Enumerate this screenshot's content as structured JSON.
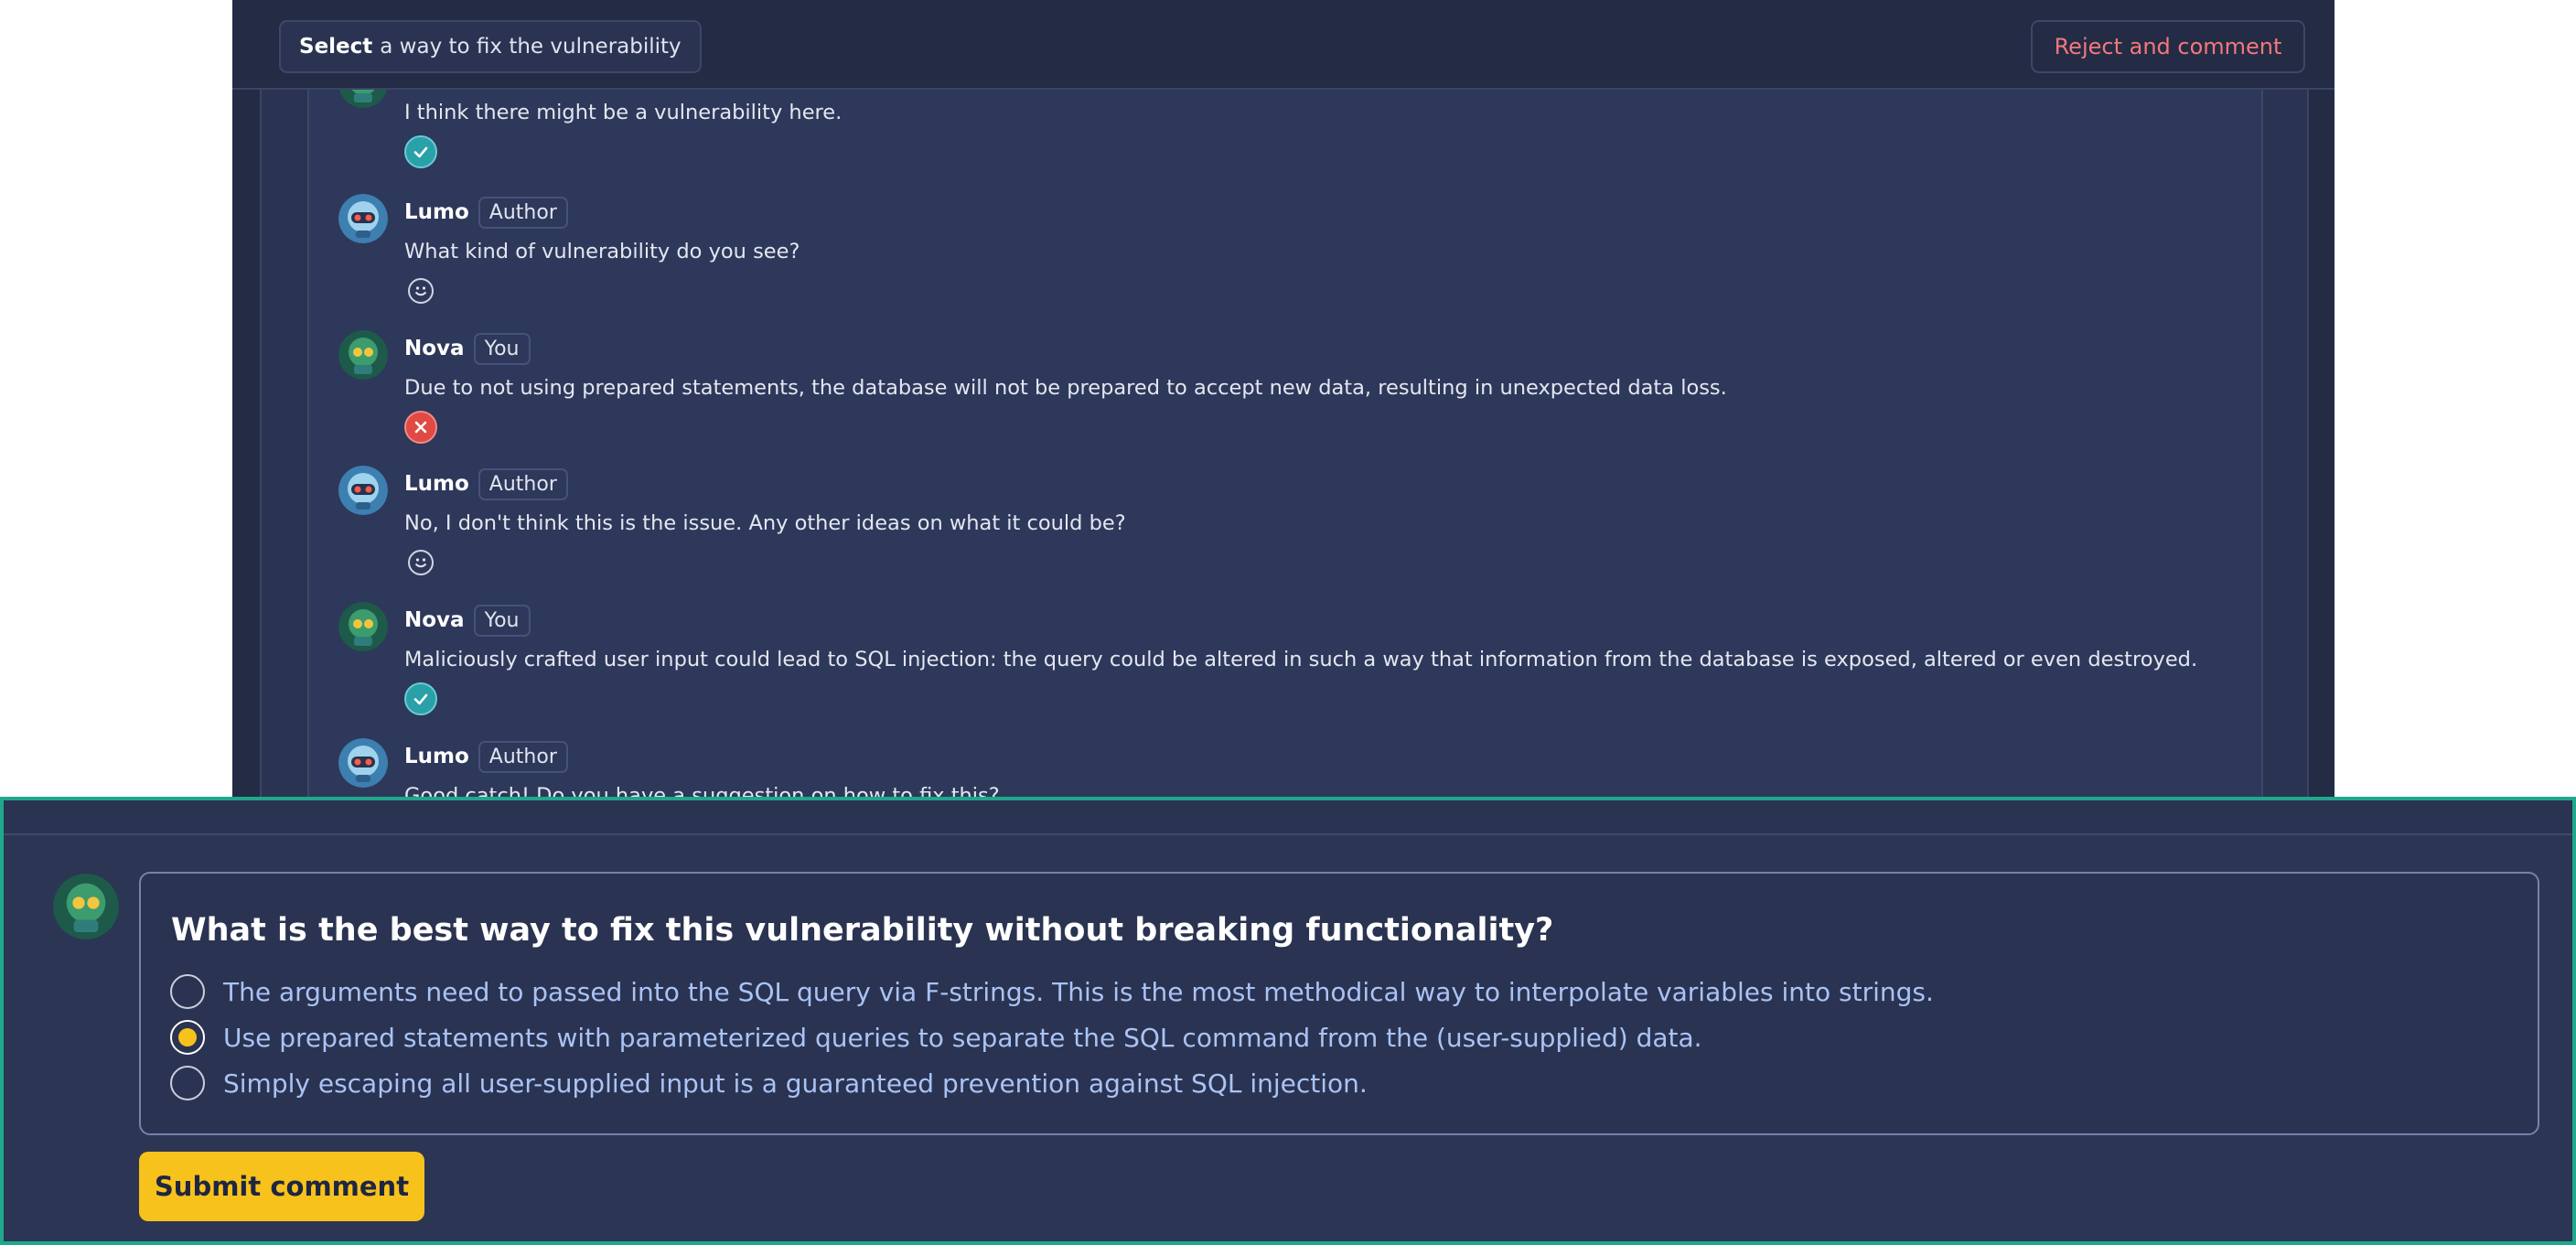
{
  "toolbar": {
    "select_bold": "Select",
    "select_rest": "a way to fix the vulnerability",
    "reject_label": "Reject and comment"
  },
  "thread": {
    "messages": [
      {
        "avatar": "robot-green-avatar",
        "name": "",
        "role": "",
        "text": "I think there might be a vulnerability here.",
        "reaction": "check-icon"
      },
      {
        "avatar": "robot-blue-avatar",
        "name": "Lumo",
        "role": "Author",
        "text": "What kind of vulnerability do you see?",
        "reaction": "smile-icon"
      },
      {
        "avatar": "robot-green-avatar",
        "name": "Nova",
        "role": "You",
        "text": "Due to not using prepared statements, the database will not be prepared to accept new data, resulting in unexpected data loss.",
        "reaction": "cross-icon"
      },
      {
        "avatar": "robot-blue-avatar",
        "name": "Lumo",
        "role": "Author",
        "text": "No, I don't think this is the issue. Any other ideas on what it could be?",
        "reaction": "smile-icon"
      },
      {
        "avatar": "robot-green-avatar",
        "name": "Nova",
        "role": "You",
        "text": "Maliciously crafted user input could lead to SQL injection: the query could be altered in such a way that information from the database is exposed, altered or even destroyed.",
        "reaction": "check-icon"
      },
      {
        "avatar": "robot-blue-avatar",
        "name": "Lumo",
        "role": "Author",
        "text": "Good catch! Do you have a suggestion on how to fix this?",
        "reaction": ""
      }
    ]
  },
  "question": {
    "title": "What is the best way to fix this vulnerability without breaking functionality?",
    "options": [
      {
        "label": "The arguments need to passed into the SQL query via F-strings. This is the most methodical way to interpolate variables into strings.",
        "selected": false
      },
      {
        "label": "Use prepared statements with parameterized queries to separate the SQL command from the (user-supplied) data.",
        "selected": true
      },
      {
        "label": "Simply escaping all user-supplied input is a guaranteed prevention against SQL injection.",
        "selected": false
      }
    ],
    "submit_label": "Submit comment"
  },
  "colors": {
    "accent_yellow": "#f7c21c",
    "panel_border_teal": "#1ea88c",
    "reject_red": "#f2787a",
    "check_teal": "#2aa0a8",
    "cross_red": "#e04a43",
    "option_text_blue": "#a9c3f5"
  }
}
